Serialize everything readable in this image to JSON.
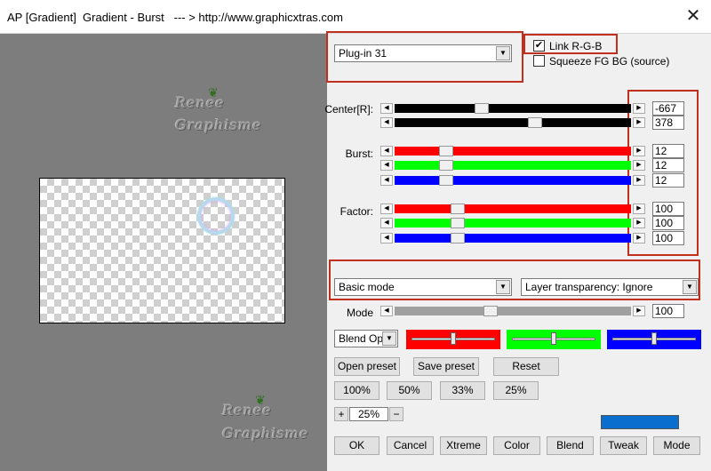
{
  "window": {
    "title": "AP [Gradient]  Gradient - Burst   --- > http://www.graphicxtras.com",
    "close_symbol": "✕"
  },
  "watermark": {
    "line1": "Renee",
    "line2": "Graphisme"
  },
  "plugin_select": {
    "value": "Plug-in 31"
  },
  "link_rgb": {
    "label": "Link R-G-B",
    "checked": true
  },
  "squeeze": {
    "label": "Squeeze FG BG (source)",
    "checked": false
  },
  "center": {
    "label": "Center[R]:",
    "values": [
      "-667",
      "378"
    ],
    "track_colors": [
      "#000000",
      "#000000"
    ],
    "levels": [
      0.36,
      0.6
    ]
  },
  "burst": {
    "label": "Burst:",
    "values": [
      "12",
      "12",
      "12"
    ],
    "track_colors": [
      "#ff0000",
      "#00ff00",
      "#0000ff"
    ],
    "levels": [
      0.2,
      0.2,
      0.2
    ]
  },
  "factor": {
    "label": "Factor:",
    "values": [
      "100",
      "100",
      "100"
    ],
    "track_colors": [
      "#ff0000",
      "#00ff00",
      "#0000ff"
    ],
    "levels": [
      0.25,
      0.25,
      0.25
    ]
  },
  "mode_select": {
    "value": "Basic mode"
  },
  "transparency_select": {
    "value": "Layer transparency: Ignore"
  },
  "mode": {
    "label": "Mode",
    "value": "100",
    "level": 0.4
  },
  "blend_select": {
    "value": "Blend Optio"
  },
  "color_sliders": [
    {
      "color": "#ff0000",
      "level": 0.5
    },
    {
      "color": "#00ff00",
      "level": 0.5
    },
    {
      "color": "#0000ff",
      "level": 0.5
    }
  ],
  "buttons": {
    "open_preset": "Open preset",
    "save_preset": "Save preset",
    "reset": "Reset",
    "zoom100": "100%",
    "zoom50": "50%",
    "zoom33": "33%",
    "zoom25": "25%",
    "plus": "+",
    "minus": "−",
    "ok": "OK",
    "cancel": "Cancel",
    "xtreme": "Xtreme",
    "color": "Color",
    "blend": "Blend",
    "tweak": "Tweak",
    "mode": "Mode"
  },
  "zoom_level": "25%",
  "swatch_color": "#0a6ecf",
  "highlight_color": "#c0301c"
}
